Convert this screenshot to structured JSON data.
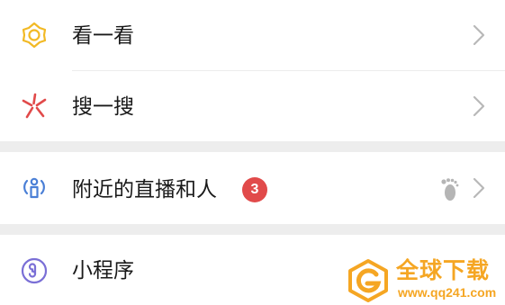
{
  "menu": {
    "look": {
      "label": "看一看",
      "icon": "look-hexagon-icon",
      "color": "#f2b924"
    },
    "search": {
      "label": "搜一搜",
      "icon": "search-star-icon",
      "color": "#e14a4a"
    },
    "nearby": {
      "label": "附近的直播和人",
      "icon": "nearby-person-icon",
      "color": "#4a7fd6",
      "badge": "3",
      "badge_color": "#e14a4a",
      "extra_icon": "footprint-icon"
    },
    "miniprogram": {
      "label": "小程序",
      "icon": "miniprogram-icon",
      "color": "#7a6fd6"
    }
  },
  "colors": {
    "chevron": "#b8b8b8",
    "divider": "#ededed",
    "section_gap": "#ededed",
    "watermark": "#f5a623"
  },
  "watermark": {
    "title": "全球下载",
    "url": "www.qq241.com"
  }
}
